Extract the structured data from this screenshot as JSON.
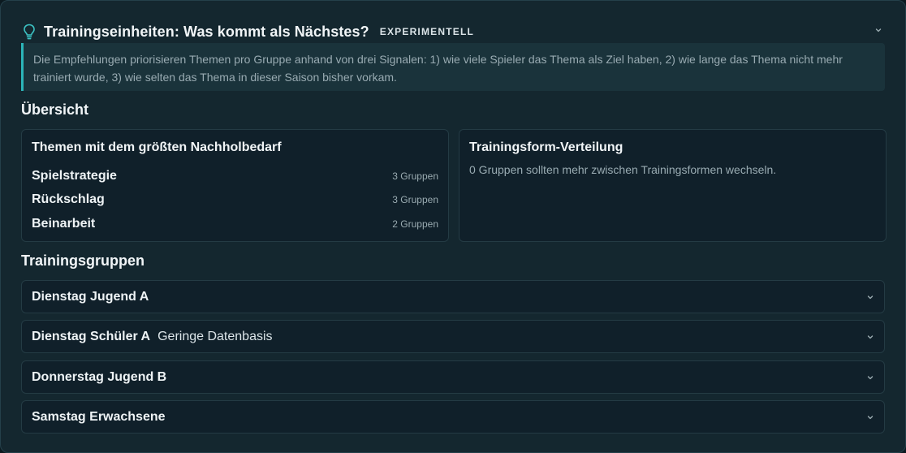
{
  "header": {
    "title": "Trainingseinheiten: Was kommt als Nächstes?",
    "badge": "EXPERIMENTELL"
  },
  "info_text": "Die Empfehlungen priorisieren Themen pro Gruppe anhand von drei Signalen: 1) wie viele Spieler das Thema als Ziel haben, 2) wie lange das Thema nicht mehr trainiert wurde, 3) wie selten das Thema in dieser Saison bisher vorkam.",
  "overview": {
    "title": "Übersicht",
    "topics_card": {
      "title": "Themen mit dem größten Nachholbedarf",
      "items": [
        {
          "name": "Spielstrategie",
          "count": "3 Gruppen"
        },
        {
          "name": "Rückschlag",
          "count": "3 Gruppen"
        },
        {
          "name": "Beinarbeit",
          "count": "2 Gruppen"
        }
      ]
    },
    "distribution_card": {
      "title": "Trainingsform-Verteilung",
      "text": "0 Gruppen sollten mehr zwischen Trainingsformen wechseln."
    }
  },
  "groups": {
    "title": "Trainingsgruppen",
    "items": [
      {
        "name": "Dienstag Jugend A",
        "note": ""
      },
      {
        "name": "Dienstag Schüler A",
        "note": "Geringe Datenbasis"
      },
      {
        "name": "Donnerstag Jugend B",
        "note": ""
      },
      {
        "name": "Samstag Erwachsene",
        "note": ""
      }
    ]
  },
  "icons": {
    "header_icon": "lightbulb-icon",
    "collapse_icon": "chevron-down-icon"
  },
  "colors": {
    "accent": "#2cb5b9",
    "background": "#14272f",
    "card": "#10202a"
  }
}
